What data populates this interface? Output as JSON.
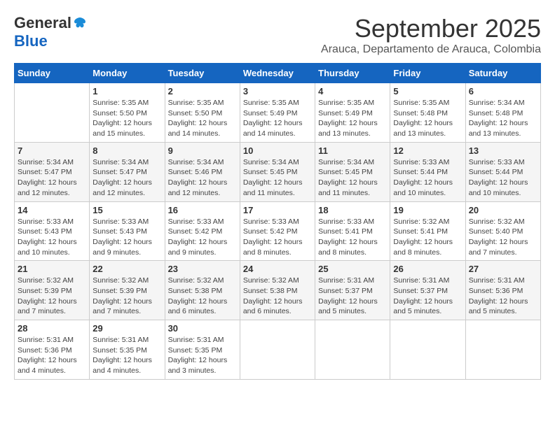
{
  "logo": {
    "general": "General",
    "blue": "Blue"
  },
  "title": "September 2025",
  "subtitle": "Arauca, Departamento de Arauca, Colombia",
  "weekdays": [
    "Sunday",
    "Monday",
    "Tuesday",
    "Wednesday",
    "Thursday",
    "Friday",
    "Saturday"
  ],
  "weeks": [
    [
      {
        "day": "",
        "content": ""
      },
      {
        "day": "1",
        "content": "Sunrise: 5:35 AM\nSunset: 5:50 PM\nDaylight: 12 hours\nand 15 minutes."
      },
      {
        "day": "2",
        "content": "Sunrise: 5:35 AM\nSunset: 5:50 PM\nDaylight: 12 hours\nand 14 minutes."
      },
      {
        "day": "3",
        "content": "Sunrise: 5:35 AM\nSunset: 5:49 PM\nDaylight: 12 hours\nand 14 minutes."
      },
      {
        "day": "4",
        "content": "Sunrise: 5:35 AM\nSunset: 5:49 PM\nDaylight: 12 hours\nand 13 minutes."
      },
      {
        "day": "5",
        "content": "Sunrise: 5:35 AM\nSunset: 5:48 PM\nDaylight: 12 hours\nand 13 minutes."
      },
      {
        "day": "6",
        "content": "Sunrise: 5:34 AM\nSunset: 5:48 PM\nDaylight: 12 hours\nand 13 minutes."
      }
    ],
    [
      {
        "day": "7",
        "content": "Sunrise: 5:34 AM\nSunset: 5:47 PM\nDaylight: 12 hours\nand 12 minutes."
      },
      {
        "day": "8",
        "content": "Sunrise: 5:34 AM\nSunset: 5:47 PM\nDaylight: 12 hours\nand 12 minutes."
      },
      {
        "day": "9",
        "content": "Sunrise: 5:34 AM\nSunset: 5:46 PM\nDaylight: 12 hours\nand 12 minutes."
      },
      {
        "day": "10",
        "content": "Sunrise: 5:34 AM\nSunset: 5:45 PM\nDaylight: 12 hours\nand 11 minutes."
      },
      {
        "day": "11",
        "content": "Sunrise: 5:34 AM\nSunset: 5:45 PM\nDaylight: 12 hours\nand 11 minutes."
      },
      {
        "day": "12",
        "content": "Sunrise: 5:33 AM\nSunset: 5:44 PM\nDaylight: 12 hours\nand 10 minutes."
      },
      {
        "day": "13",
        "content": "Sunrise: 5:33 AM\nSunset: 5:44 PM\nDaylight: 12 hours\nand 10 minutes."
      }
    ],
    [
      {
        "day": "14",
        "content": "Sunrise: 5:33 AM\nSunset: 5:43 PM\nDaylight: 12 hours\nand 10 minutes."
      },
      {
        "day": "15",
        "content": "Sunrise: 5:33 AM\nSunset: 5:43 PM\nDaylight: 12 hours\nand 9 minutes."
      },
      {
        "day": "16",
        "content": "Sunrise: 5:33 AM\nSunset: 5:42 PM\nDaylight: 12 hours\nand 9 minutes."
      },
      {
        "day": "17",
        "content": "Sunrise: 5:33 AM\nSunset: 5:42 PM\nDaylight: 12 hours\nand 8 minutes."
      },
      {
        "day": "18",
        "content": "Sunrise: 5:33 AM\nSunset: 5:41 PM\nDaylight: 12 hours\nand 8 minutes."
      },
      {
        "day": "19",
        "content": "Sunrise: 5:32 AM\nSunset: 5:41 PM\nDaylight: 12 hours\nand 8 minutes."
      },
      {
        "day": "20",
        "content": "Sunrise: 5:32 AM\nSunset: 5:40 PM\nDaylight: 12 hours\nand 7 minutes."
      }
    ],
    [
      {
        "day": "21",
        "content": "Sunrise: 5:32 AM\nSunset: 5:39 PM\nDaylight: 12 hours\nand 7 minutes."
      },
      {
        "day": "22",
        "content": "Sunrise: 5:32 AM\nSunset: 5:39 PM\nDaylight: 12 hours\nand 7 minutes."
      },
      {
        "day": "23",
        "content": "Sunrise: 5:32 AM\nSunset: 5:38 PM\nDaylight: 12 hours\nand 6 minutes."
      },
      {
        "day": "24",
        "content": "Sunrise: 5:32 AM\nSunset: 5:38 PM\nDaylight: 12 hours\nand 6 minutes."
      },
      {
        "day": "25",
        "content": "Sunrise: 5:31 AM\nSunset: 5:37 PM\nDaylight: 12 hours\nand 5 minutes."
      },
      {
        "day": "26",
        "content": "Sunrise: 5:31 AM\nSunset: 5:37 PM\nDaylight: 12 hours\nand 5 minutes."
      },
      {
        "day": "27",
        "content": "Sunrise: 5:31 AM\nSunset: 5:36 PM\nDaylight: 12 hours\nand 5 minutes."
      }
    ],
    [
      {
        "day": "28",
        "content": "Sunrise: 5:31 AM\nSunset: 5:36 PM\nDaylight: 12 hours\nand 4 minutes."
      },
      {
        "day": "29",
        "content": "Sunrise: 5:31 AM\nSunset: 5:35 PM\nDaylight: 12 hours\nand 4 minutes."
      },
      {
        "day": "30",
        "content": "Sunrise: 5:31 AM\nSunset: 5:35 PM\nDaylight: 12 hours\nand 3 minutes."
      },
      {
        "day": "",
        "content": ""
      },
      {
        "day": "",
        "content": ""
      },
      {
        "day": "",
        "content": ""
      },
      {
        "day": "",
        "content": ""
      }
    ]
  ]
}
